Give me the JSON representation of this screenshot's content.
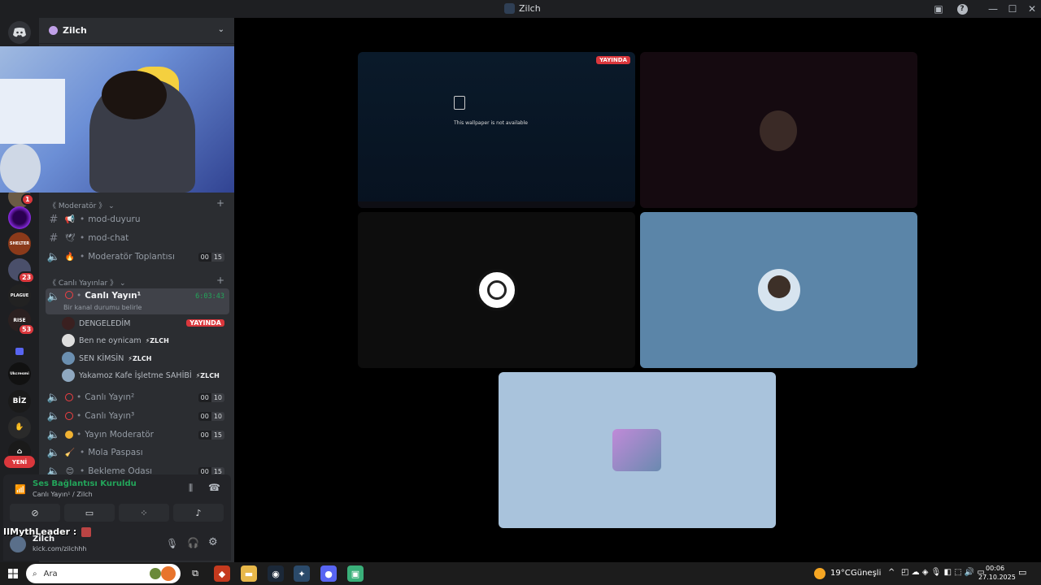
{
  "window": {
    "title": "Zilch"
  },
  "server": {
    "name": "Zilch"
  },
  "guild_badges": {
    "g1": "1",
    "g2": "23",
    "g3": "53"
  },
  "guild_labels": {
    "shelter": "SHELTER",
    "plague": "PLAGUE",
    "rise": "RISE",
    "ukcresmi": "Ukcresmi",
    "biz": "BİZ",
    "yeni": "YENİ"
  },
  "categories": {
    "moderator": "《 Moderatör 》",
    "canli": "《 Canlı Yayınlar 》"
  },
  "channels": {
    "mod_duyuru": {
      "emoji": "📢",
      "name": "mod-duyuru"
    },
    "mod_chat": {
      "emoji": "🕊",
      "name": "mod-chat"
    },
    "mod_toplanti": {
      "emoji": "🔥",
      "name": "Moderatör Toplantısı",
      "count_a": "00",
      "count_b": "15"
    },
    "canli1": {
      "name": "Canlı Yayın¹",
      "timer": "6:03:43",
      "status": "Bir kanal durumu belirle"
    },
    "canli2": {
      "name": "Canlı Yayın²",
      "count_a": "00",
      "count_b": "10"
    },
    "canli3": {
      "name": "Canlı Yayın³",
      "count_a": "00",
      "count_b": "10"
    },
    "yayin_mod": {
      "name": "Yayın Moderatör",
      "count_a": "00",
      "count_b": "15"
    },
    "mola": {
      "emoji": "🧹",
      "name": "Mola Paspası"
    },
    "bekleme": {
      "emoji": "😊",
      "name": "Bekleme Odası",
      "count_a": "00",
      "count_b": "15"
    }
  },
  "voice_users": [
    {
      "name": "DENGELEDİM",
      "live": "YAYINDA"
    },
    {
      "name": "Ben ne oynicam",
      "tag": "⚡ZLCH"
    },
    {
      "name": "SEN KİMSİN",
      "tag": "⚡ZLCH"
    },
    {
      "name": "Yakamoz Kafe İşletme SAHİBİ",
      "tag": "⚡ZLCH"
    }
  ],
  "voice_connection": {
    "status": "Ses Bağlantısı Kuruldu",
    "channel": "Canlı Yayın¹ / Zilch"
  },
  "user_panel": {
    "overlay": "IIMythLeader :",
    "username": "Zilch",
    "status": "kick.com/zilchhh"
  },
  "stream": {
    "live_badge": "YAYINDA",
    "wallpaper_msg": "This wallpaper is not available"
  },
  "taskbar": {
    "search_placeholder": "Ara",
    "weather_temp": "19°C",
    "weather_desc": "Güneşli",
    "time": "00:06",
    "date": "27.10.2025"
  },
  "colors": {
    "accent": "#5865f2",
    "live": "#da373c",
    "connected": "#23a55a",
    "tile_blue": "#5b85a8",
    "tile_lightblue": "#a9c3dc"
  }
}
